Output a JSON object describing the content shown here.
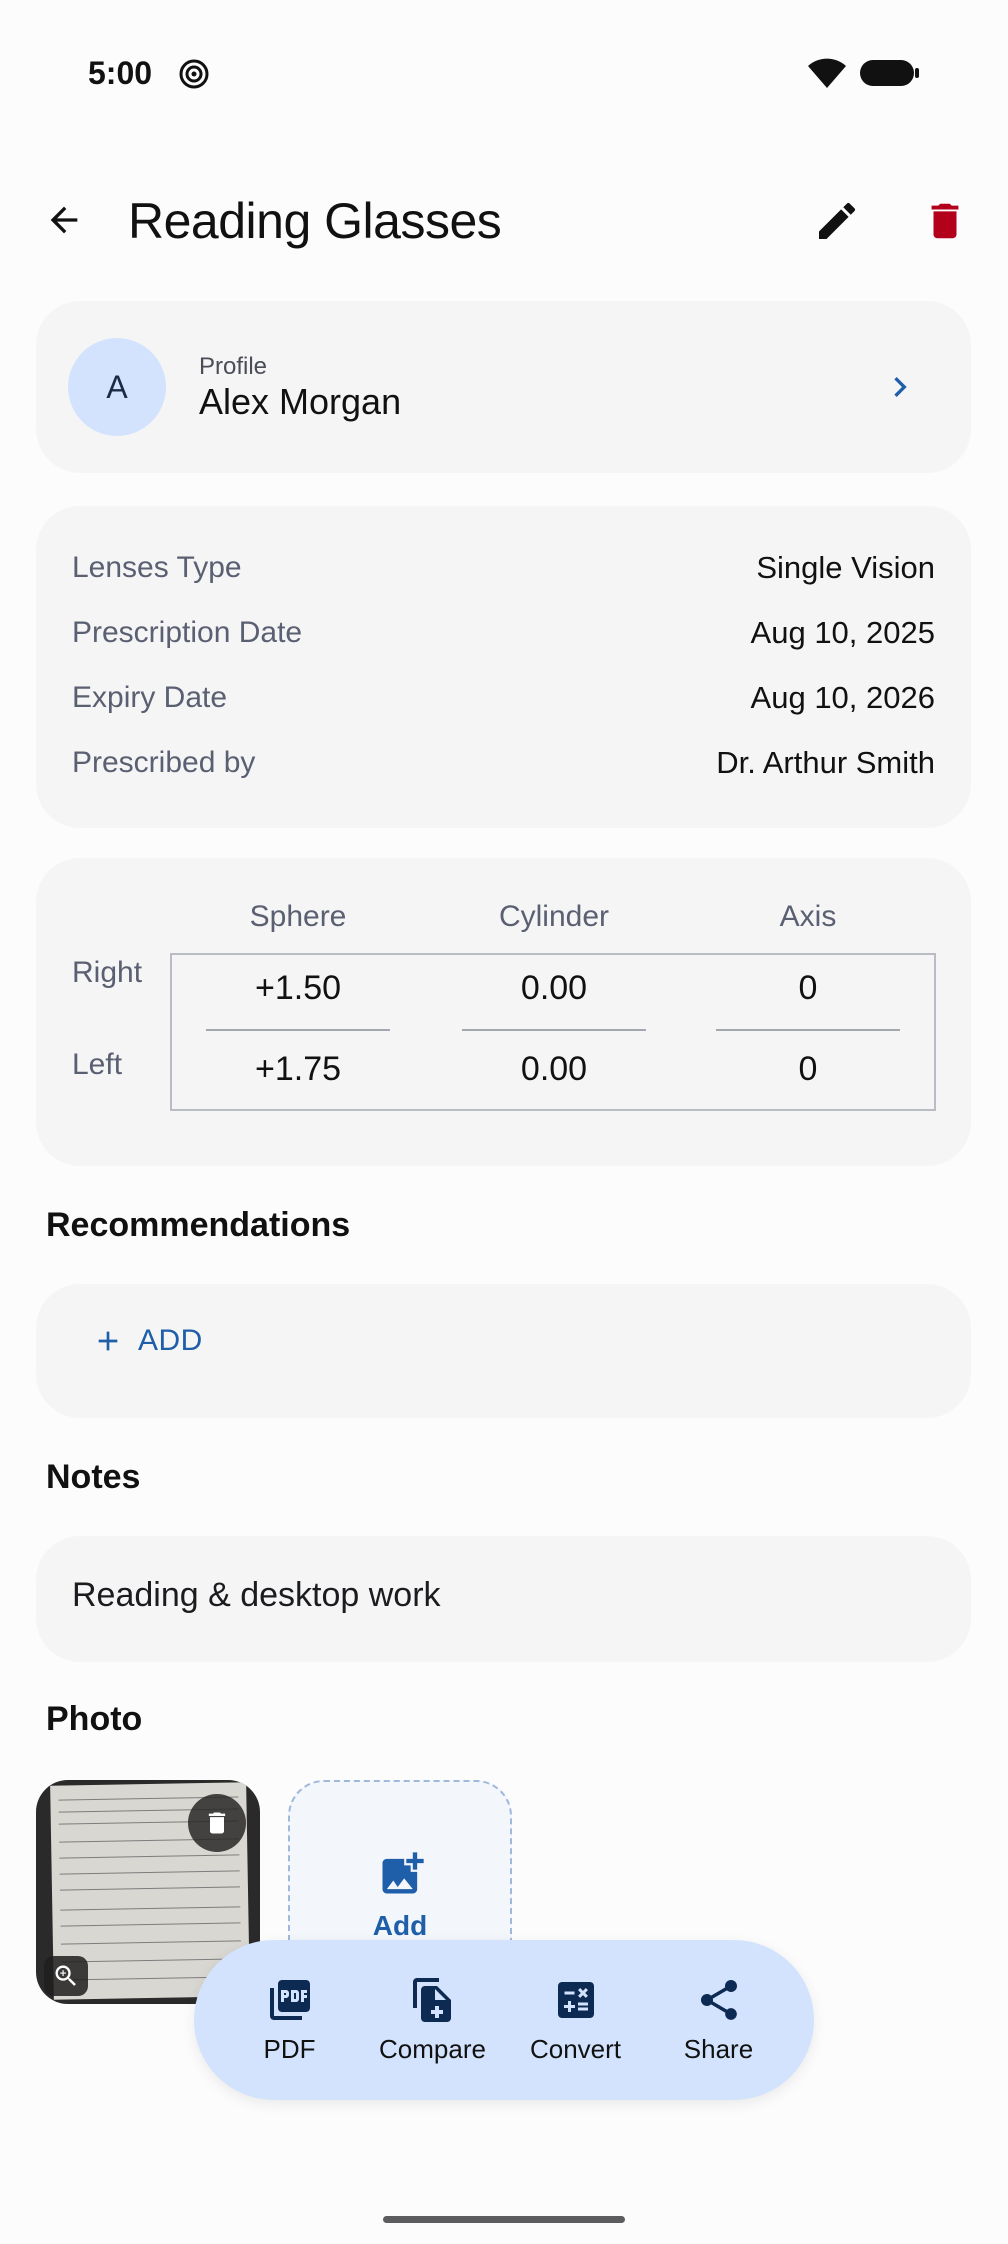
{
  "status_bar": {
    "time": "5:00"
  },
  "header": {
    "title": "Reading Glasses"
  },
  "profile": {
    "label": "Profile",
    "initial": "A",
    "name": "Alex Morgan"
  },
  "details": [
    {
      "label": "Lenses Type",
      "value": "Single Vision"
    },
    {
      "label": "Prescription Date",
      "value": "Aug 10, 2025"
    },
    {
      "label": "Expiry Date",
      "value": "Aug 10, 2026"
    },
    {
      "label": "Prescribed by",
      "value": "Dr. Arthur Smith"
    }
  ],
  "prescription": {
    "columns": [
      "Sphere",
      "Cylinder",
      "Axis"
    ],
    "rows": [
      {
        "side": "Right",
        "values": [
          "+1.50",
          "0.00",
          "0"
        ]
      },
      {
        "side": "Left",
        "values": [
          "+1.75",
          "0.00",
          "0"
        ]
      }
    ]
  },
  "recommendations": {
    "title": "Recommendations",
    "add_label": "ADD"
  },
  "notes": {
    "title": "Notes",
    "text": "Reading & desktop work"
  },
  "photo": {
    "title": "Photo",
    "add_label": "Add"
  },
  "actions": [
    {
      "label": "PDF",
      "icon": "pdf-icon"
    },
    {
      "label": "Compare",
      "icon": "compare-icon"
    },
    {
      "label": "Convert",
      "icon": "calculator-icon"
    },
    {
      "label": "Share",
      "icon": "share-icon"
    }
  ],
  "colors": {
    "accent": "#1f5ea8",
    "delete": "#b3001b",
    "action_bar": "#d3e3fd",
    "card": "#f5f5f6"
  }
}
